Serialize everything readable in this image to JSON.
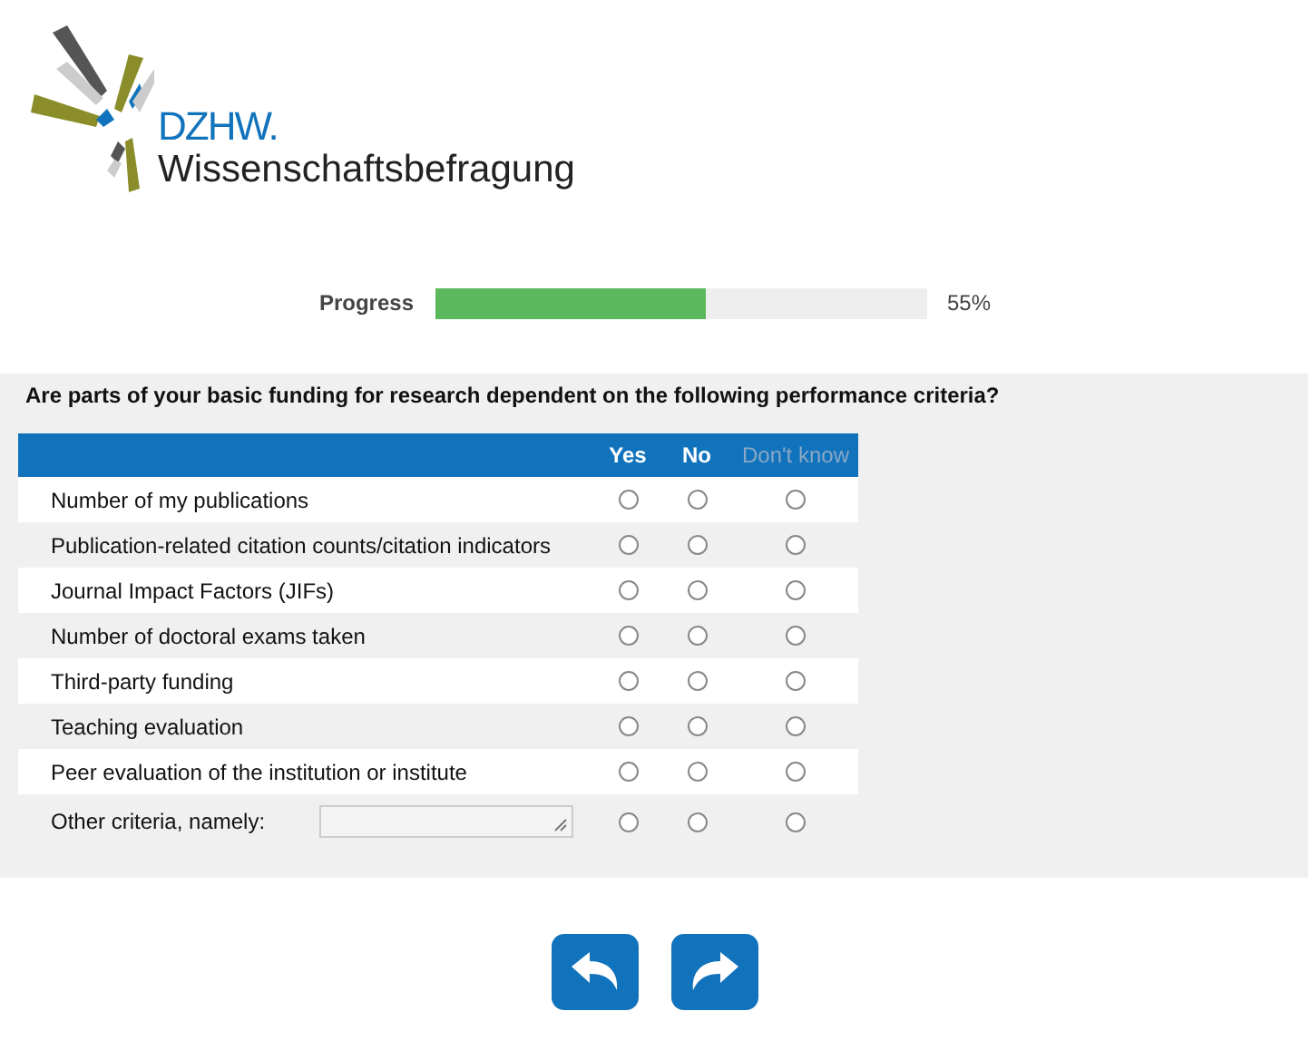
{
  "logo": {
    "acronym": "DZHW.",
    "name": "Wissenschaftsbefragung"
  },
  "progress": {
    "label": "Progress",
    "level": 0.55,
    "reading": "55%"
  },
  "question": "Are parts of your basic funding for research dependent on the following performance criteria?",
  "columns": [
    {
      "label": "Yes",
      "dimmed": false
    },
    {
      "label": "No",
      "dimmed": false
    },
    {
      "label": "Don't know",
      "dimmed": true
    }
  ],
  "rows": [
    {
      "kind": "plain",
      "label": "Number of my publications",
      "options": [
        {
          "selected": false
        },
        {
          "selected": false
        },
        {
          "selected": false
        }
      ]
    },
    {
      "kind": "plain",
      "label": "Publication-related citation counts/citation indicators",
      "options": [
        {
          "selected": false
        },
        {
          "selected": false
        },
        {
          "selected": false
        }
      ]
    },
    {
      "kind": "plain",
      "label": "Journal Impact Factors (JIFs)",
      "options": [
        {
          "selected": false
        },
        {
          "selected": false
        },
        {
          "selected": false
        }
      ]
    },
    {
      "kind": "plain",
      "label": "Number of doctoral exams taken",
      "options": [
        {
          "selected": false
        },
        {
          "selected": false
        },
        {
          "selected": false
        }
      ]
    },
    {
      "kind": "plain",
      "label": "Third-party funding",
      "options": [
        {
          "selected": false
        },
        {
          "selected": false
        },
        {
          "selected": false
        }
      ]
    },
    {
      "kind": "plain",
      "label": "Teaching evaluation",
      "options": [
        {
          "selected": false
        },
        {
          "selected": false
        },
        {
          "selected": false
        }
      ]
    },
    {
      "kind": "plain",
      "label": "Peer evaluation of the institution or institute",
      "options": [
        {
          "selected": false
        },
        {
          "selected": false
        },
        {
          "selected": false
        }
      ]
    },
    {
      "kind": "text-input",
      "label": "Other criteria, namely:",
      "options": [
        {
          "selected": false
        },
        {
          "selected": false
        },
        {
          "selected": false
        }
      ]
    }
  ],
  "nav": [
    {
      "kind": "back"
    },
    {
      "kind": "forward"
    }
  ]
}
